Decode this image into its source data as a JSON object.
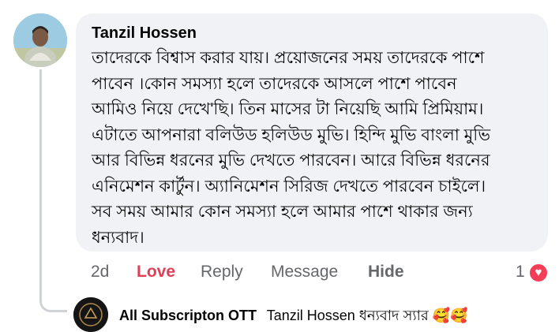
{
  "comment": {
    "author": "Tanzil Hossen",
    "lines": [
      "তাদেরকে বিশ্বাস করার যায়। প্রয়োজনের সময় তাদেরকে পাশে",
      "পাবেন ।কোন সমস্যা হলে তাদেরকে আসলে পাশে পাবেন",
      "আমিও নিয়ে দেখে'ছি। তিন মাসের টা নিয়েছি আমি প্রিমিয়াম।",
      "এটাতে আপনারা বলিউড হলিউড মুভি। হিন্দি মুভি বাংলা মুভি",
      "আর বিভিন্ন ধরনের মুভি দেখতে পারবেন। আরে বিভিন্ন ধরনের",
      "এনিমেশন কার্টুন। অ্যানিমেশন সিরিজ দেখতে পারবেন চাইলে।",
      "সব সময় আমার কোন সমস্যা হলে আমার পাশে থাকার জন্য",
      "ধন্যবাদ।"
    ],
    "time": "2d",
    "love_label": "Love",
    "reply_label": "Reply",
    "message_label": "Message",
    "hide_label": "Hide",
    "reaction_count": "1",
    "reaction_icon": "heart-icon"
  },
  "reply": {
    "author": "All Subscripton OTT",
    "text": "Tanzil Hossen ধন্যবাদ স্যার 🥰🥰"
  },
  "colors": {
    "bubble": "#f0f2f5",
    "love": "#e13f55",
    "muted": "#65676b",
    "heart": "#f33e58"
  }
}
